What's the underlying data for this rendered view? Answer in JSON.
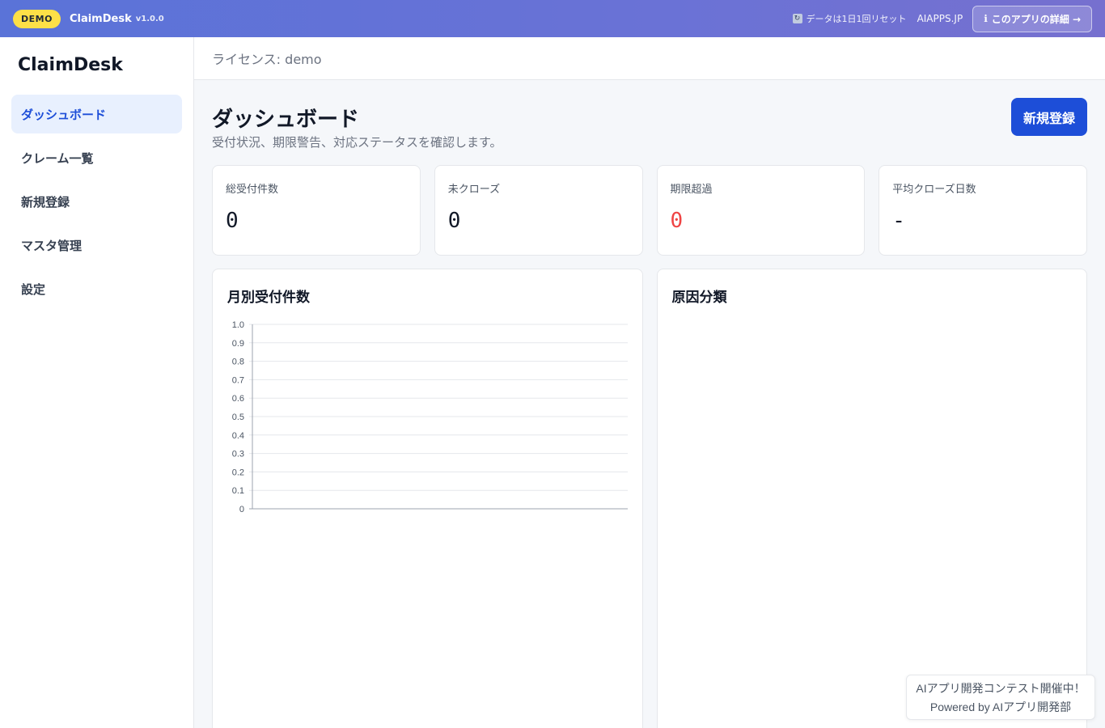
{
  "topbar": {
    "demo_badge": "DEMO",
    "app_name": "ClaimDesk",
    "version": "v1.0.0",
    "reset_note": "データは1日1回リセット",
    "site_link": "AIAPPS.JP",
    "details_button": "このアプリの詳細 →"
  },
  "sidebar": {
    "brand": "ClaimDesk",
    "items": [
      {
        "label": "ダッシュボード",
        "active": true
      },
      {
        "label": "クレーム一覧",
        "active": false
      },
      {
        "label": "新規登録",
        "active": false
      },
      {
        "label": "マスタ管理",
        "active": false
      },
      {
        "label": "設定",
        "active": false
      }
    ]
  },
  "license": "ライセンス: demo",
  "page": {
    "title": "ダッシュボード",
    "subtitle": "受付状況、期限警告、対応ステータスを確認します。",
    "new_button": "新規登録"
  },
  "stats": [
    {
      "label": "総受付件数",
      "value": "0"
    },
    {
      "label": "未クローズ",
      "value": "0"
    },
    {
      "label": "期限超過",
      "value": "0"
    },
    {
      "label": "平均クローズ日数",
      "value": "-"
    }
  ],
  "panels": {
    "monthly_title": "月別受付件数",
    "cause_title": "原因分類"
  },
  "chart_data": {
    "type": "bar",
    "title": "月別受付件数",
    "categories": [],
    "values": [],
    "ylim": [
      0,
      1.0
    ],
    "yticks": [
      "0",
      "0.1",
      "0.2",
      "0.3",
      "0.4",
      "0.5",
      "0.6",
      "0.7",
      "0.8",
      "0.9",
      "1.0"
    ],
    "grid": true
  },
  "footer": {
    "line1": "AIアプリ開発コンテスト開催中！",
    "line2": "Powered by AIアプリ開発部"
  },
  "colors": {
    "primary": "#1d4ed8",
    "warning": "#ef4444",
    "demo_badge": "#fde047"
  }
}
